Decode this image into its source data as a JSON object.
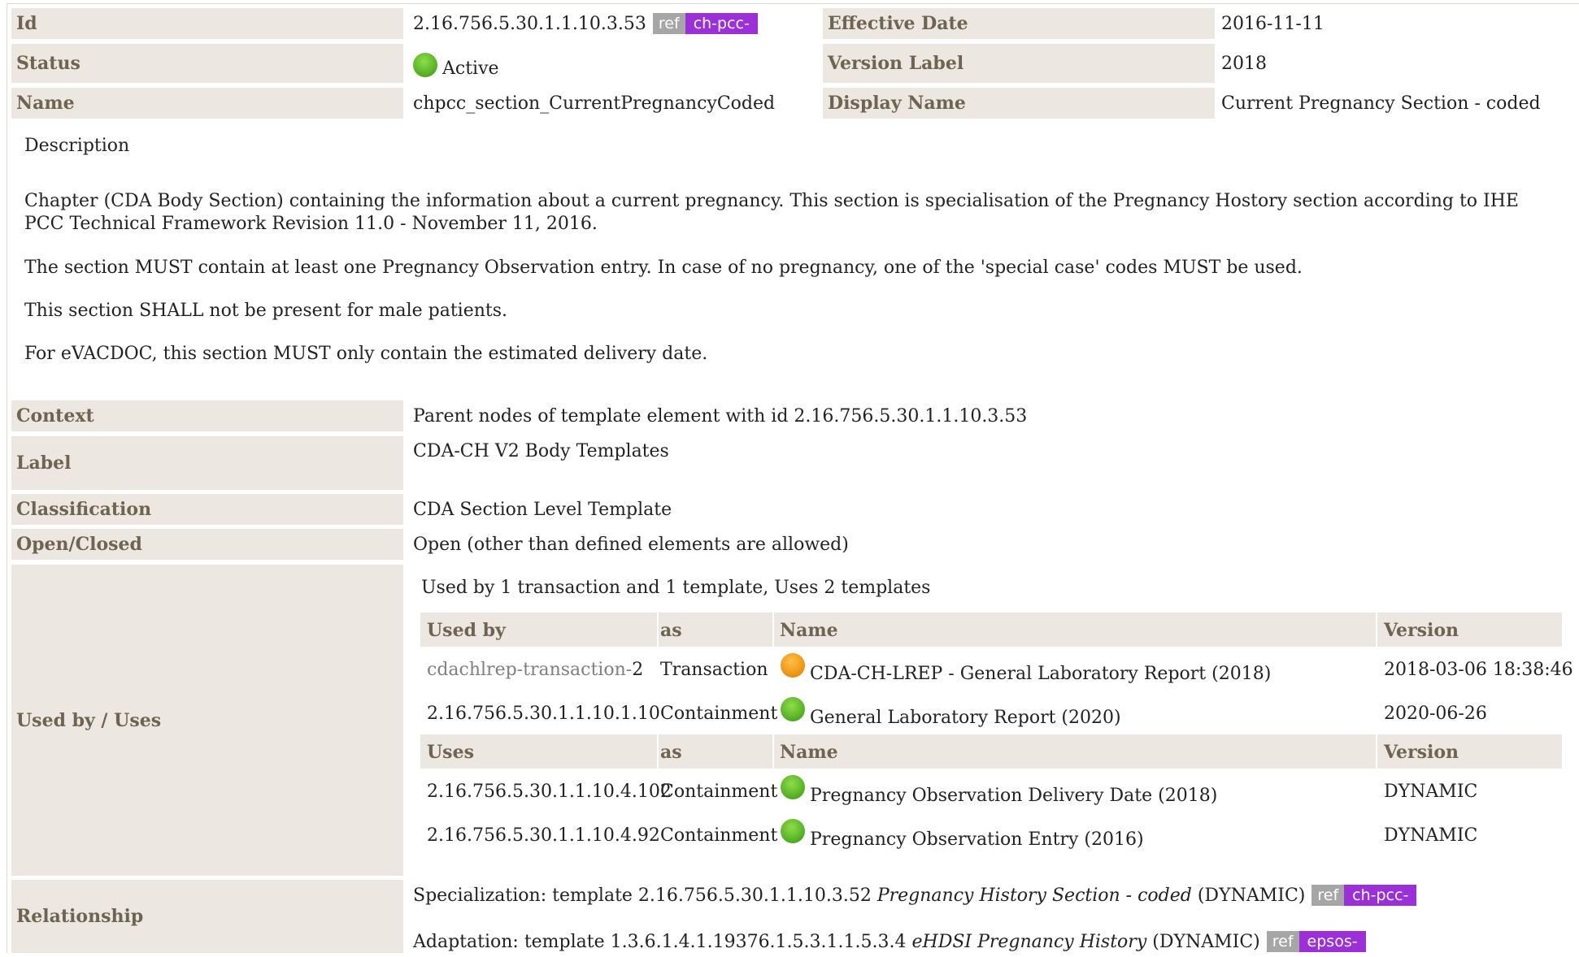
{
  "header": {
    "id_label": "Id",
    "id_value": "2.16.756.5.30.1.1.10.3.53",
    "id_ref": "ref",
    "id_prefix": "ch-pcc-",
    "effective_date_label": "Effective Date",
    "effective_date_value": "2016-11-11",
    "status_label": "Status",
    "status_value": "Active",
    "status_icon": "green-status-dot",
    "version_label_label": "Version Label",
    "version_label_value": "2018",
    "name_label": "Name",
    "name_value": "chpcc_section_CurrentPregnancyCoded",
    "display_name_label": "Display Name",
    "display_name_value": "Current Pregnancy Section - coded"
  },
  "description": {
    "heading": "Description",
    "paragraphs": [
      "Chapter (CDA Body Section) containing the information about a current pregnancy. This section is specialisation of the Pregnancy Hostory section according to IHE PCC Technical Framework Revision 11.0 - November 11, 2016.",
      "The section MUST contain at least one Pregnancy Observation entry. In case of no pregnancy, one of the 'special case' codes MUST be used.",
      "This section SHALL not be present for male patients.",
      "For eVACDOC, this section MUST only contain the estimated delivery date."
    ]
  },
  "details": {
    "context_label": "Context",
    "context_value": "Parent nodes of template element with id 2.16.756.5.30.1.1.10.3.53",
    "label_label": "Label",
    "label_value": "CDA-CH V2 Body Templates",
    "classification_label": "Classification",
    "classification_value": "CDA Section Level Template",
    "open_closed_label": "Open/Closed",
    "open_closed_value": "Open (other than defined elements are allowed)",
    "used_by_uses_label": "Used by / Uses",
    "relationship_label": "Relationship"
  },
  "usage": {
    "summary": "Used by 1 transaction and 1 template, Uses 2 templates",
    "used_by_header": {
      "col1": "Used by",
      "col2": "as",
      "col3": "Name",
      "col4": "Version"
    },
    "used_by_rows": [
      {
        "link": "cdachlrep-transaction-",
        "suffix": "2",
        "as": "Transaction",
        "icon": "orange-status-dot",
        "name": "CDA-CH-LREP - General Laboratory Report (2018)",
        "version": "2018-03-06 18:38:46"
      },
      {
        "link": "",
        "suffix": "2.16.756.5.30.1.1.10.1.10",
        "as": "Containment",
        "icon": "green-status-dot",
        "name": "General Laboratory Report (2020)",
        "version": "2020-06-26"
      }
    ],
    "uses_header": {
      "col1": "Uses",
      "col2": "as",
      "col3": "Name",
      "col4": "Version"
    },
    "uses_rows": [
      {
        "id": "2.16.756.5.30.1.1.10.4.102",
        "as": "Containment",
        "icon": "green-status-dot",
        "name": "Pregnancy Observation Delivery Date (2018)",
        "version": "DYNAMIC"
      },
      {
        "id": "2.16.756.5.30.1.1.10.4.92",
        "as": "Containment",
        "icon": "green-status-dot",
        "name": "Pregnancy Observation Entry (2016)",
        "version": "DYNAMIC"
      }
    ]
  },
  "relationships": [
    {
      "prefix_text": "Specialization: template 2.16.756.5.30.1.1.10.3.52 ",
      "title": "Pregnancy History Section - coded",
      "flex": " (DYNAMIC)",
      "ref": "ref",
      "badge": "ch-pcc-"
    },
    {
      "prefix_text": "Adaptation: template 1.3.6.1.4.1.19376.1.5.3.1.1.5.3.4 ",
      "title": "eHDSI Pregnancy History",
      "flex": " (DYNAMIC)",
      "ref": "ref",
      "badge": "epsos-"
    }
  ],
  "colors": {
    "label_bg": "#ece8e1",
    "label_text": "#6f6451",
    "badge_ref": "#a6a6a6",
    "badge_prefix": "#9b2fd8",
    "active_green": "#5cb82a",
    "pending_orange": "#f29a16"
  }
}
